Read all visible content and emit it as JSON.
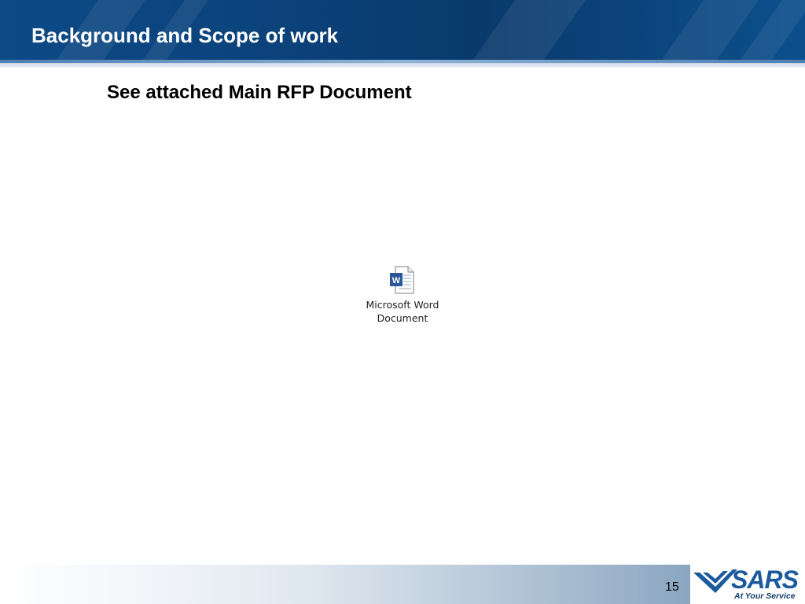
{
  "slide": {
    "title": "Background and Scope of work",
    "body_text": "See attached Main RFP Document",
    "page_number": "15"
  },
  "embedded_object": {
    "icon": "word-document-icon",
    "label_line1": "Microsoft Word",
    "label_line2": "Document"
  },
  "logo": {
    "name": "SARS",
    "tagline": "At Your Service"
  },
  "colors": {
    "title_bar": "#0b427a",
    "word_blue": "#2b579a",
    "logo_blue": "#1b5a9c"
  }
}
